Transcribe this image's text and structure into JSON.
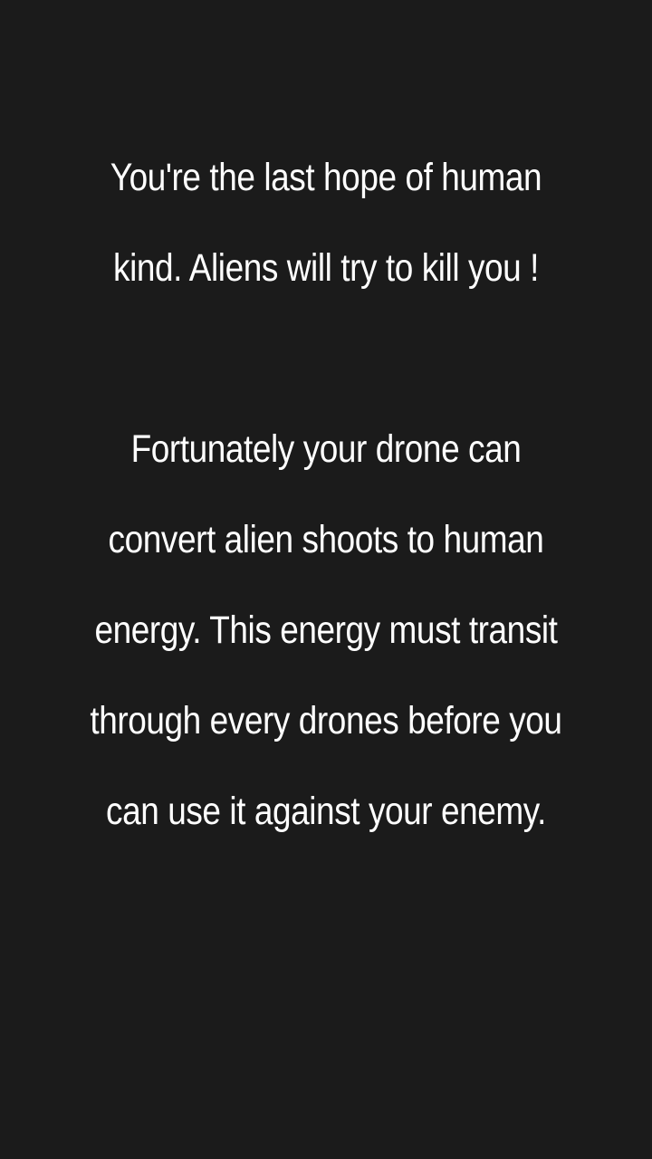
{
  "intro": {
    "paragraph1": [
      "You're the last hope of human",
      "kind. Aliens will try to kill you !"
    ],
    "paragraph2": [
      "Fortunately your drone can",
      "convert alien shoots to human",
      "energy. This energy must transit",
      "through every drones before you",
      "can use it against your enemy."
    ]
  },
  "colors": {
    "background": "#1b1b1b",
    "text": "#ffffff"
  }
}
